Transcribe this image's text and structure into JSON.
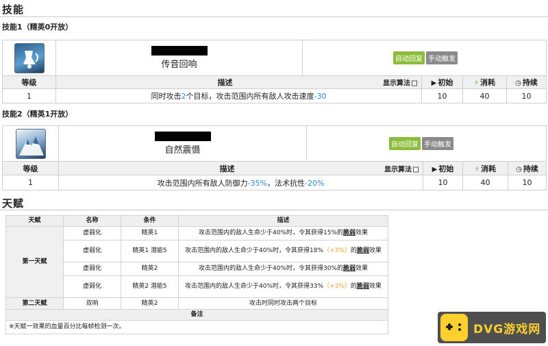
{
  "skills_section": {
    "title": "技能"
  },
  "skill1": {
    "header": "技能1（精英0开放）",
    "name": "传音回响",
    "tag_auto": "自动回复",
    "tag_manual": "手动触发",
    "col_level": "等级",
    "col_desc": "描述",
    "algo_label": "显示算法",
    "col_init": "初始",
    "col_cost": "消耗",
    "col_dur": "持续",
    "row": {
      "level": "1",
      "d1": "同时攻击",
      "d2": "2",
      "d3": "个目标，攻击范围内所有敌人攻击速度",
      "d4": "-30",
      "init": "10",
      "cost": "40",
      "dur": "10"
    }
  },
  "skill2": {
    "header": "技能2（精英1开放）",
    "name": "自然震慑",
    "tag_auto": "自动回复",
    "tag_manual": "手动触发",
    "col_level": "等级",
    "col_desc": "描述",
    "algo_label": "显示算法",
    "col_init": "初始",
    "col_cost": "消耗",
    "col_dur": "持续",
    "row": {
      "level": "1",
      "d1": "攻击范围内所有敌人防御力",
      "d2": "-35%",
      "d3": "，法术抗性",
      "d4": "-20%",
      "init": "10",
      "cost": "40",
      "dur": "10"
    }
  },
  "talent_section": {
    "title": "天赋"
  },
  "talent_table": {
    "headers": [
      "天赋",
      "名称",
      "条件",
      "描述"
    ],
    "group1": "第一天赋",
    "group2": "第二天赋",
    "r1": {
      "name": "虚弱化",
      "cond": "精英1",
      "d1": "攻击范围内的敌人生命少于40%时，令其获得15%的",
      "d2": "脆弱",
      "d3": "效果"
    },
    "r2": {
      "name": "虚弱化",
      "cond": "精英1 潜能5",
      "d1": "攻击范围内的敌人生命少于40%时，令其获得18%",
      "d2": "（+3%）",
      "d3": "的",
      "d4": "脆弱",
      "d5": "效果"
    },
    "r3": {
      "name": "虚弱化",
      "cond": "精英2",
      "d1": "攻击范围内的敌人生命少于40%时，令其获得30%的",
      "d2": "脆弱",
      "d3": "效果"
    },
    "r4": {
      "name": "虚弱化",
      "cond": "精英2 潜能5",
      "d1": "攻击范围内的敌人生命少于40%时，令其获得33%",
      "d2": "（+3%）",
      "d3": "的",
      "d4": "脆弱",
      "d5": "效果"
    },
    "r5": {
      "name": "双响",
      "cond": "精英2",
      "desc": "攻击时同时攻击两个目标"
    },
    "note_header": "备注",
    "note": "※天赋一效果的血量百分比每帧检测一次。"
  },
  "watermark": {
    "text": "DVG游戏网"
  },
  "colors": {
    "accent_green": "#8cbd3a",
    "manual_gray": "#8a8a8a",
    "value_blue": "#2a86cf",
    "potential_orange": "#f0a030"
  },
  "icons": [
    "bell-skill-icon",
    "mountain-skill-icon",
    "play-icon",
    "lightning-icon",
    "clock-icon",
    "checkbox-icon"
  ]
}
